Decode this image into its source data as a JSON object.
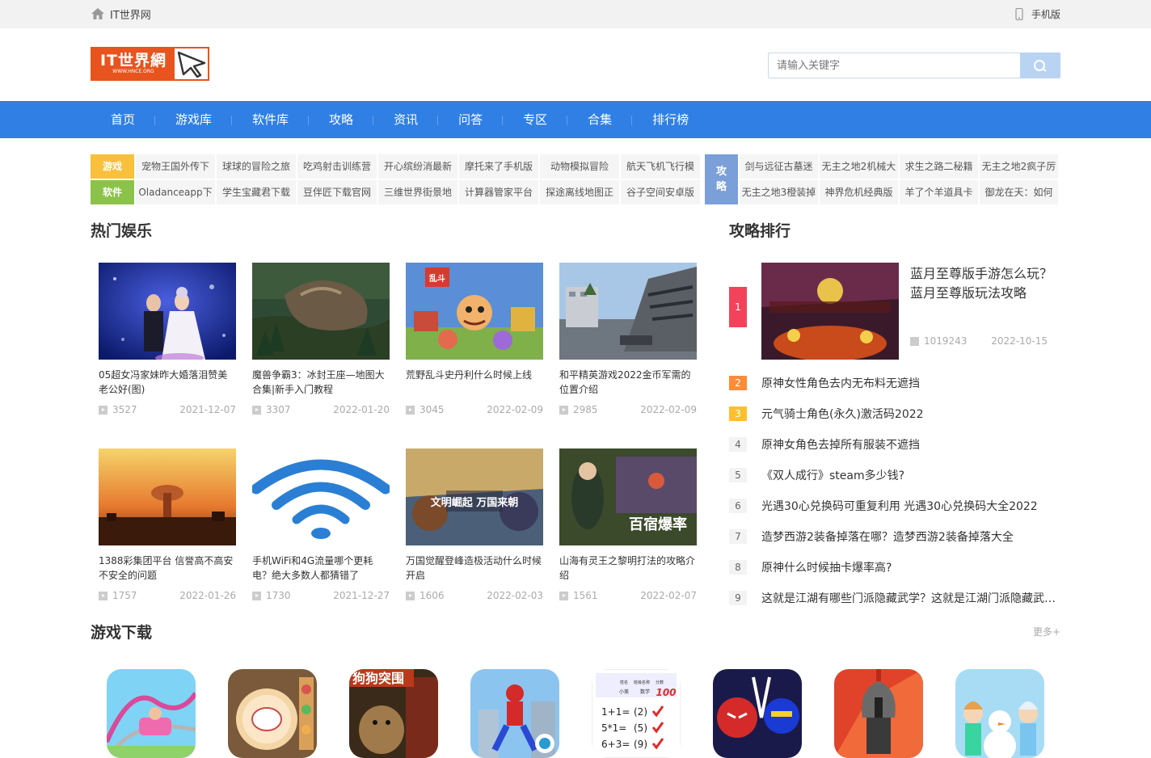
{
  "topbar": {
    "site_name": "IT世界网",
    "mobile_label": "手机版"
  },
  "logo": {
    "main": "IT世界網",
    "sub": "WWW.HNCE.ORG"
  },
  "search": {
    "placeholder": "请输入关键字"
  },
  "nav": [
    "首页",
    "游戏库",
    "软件库",
    "攻略",
    "资讯",
    "问答",
    "专区",
    "合集",
    "排行榜"
  ],
  "tags": {
    "games_label": "游戏",
    "games": [
      "宠物王国外传下",
      "球球的冒险之旅",
      "吃鸡射击训练营",
      "开心缤纷消最新",
      "摩托来了手机版",
      "动物模拟冒险",
      "航天飞机飞行模"
    ],
    "software_label": "软件",
    "software": [
      "Oladanceapp下",
      "学生宝藏君下载",
      "豆伴匠下载官网",
      "三维世界街景地",
      "计算器管家平台",
      "探途离线地图正",
      "谷子空间安卓版"
    ],
    "guide_label_1": "攻",
    "guide_label_2": "略",
    "guides": [
      "剑与远征古墓迷",
      "无主之地2机械大",
      "求生之路二秘籍",
      "无主之地2疯子厉",
      "无主之地3橙装掉",
      "神界危机经典版",
      "羊了个羊道具卡",
      "御龙在天：如何"
    ]
  },
  "sections": {
    "hot": "热门娱乐",
    "rank": "攻略排行",
    "download": "游戏下载",
    "more": "更多+"
  },
  "hot_cards": [
    {
      "title": "05超女冯家妹昨大婚落泪赞美老公好(图)",
      "views": "3527",
      "date": "2021-12-07"
    },
    {
      "title": "魔兽争霸3：冰封王座—地图大合集|新手入门教程",
      "views": "3307",
      "date": "2022-01-20"
    },
    {
      "title": "荒野乱斗史丹利什么时候上线",
      "views": "3045",
      "date": "2022-02-09"
    },
    {
      "title": "和平精英游戏2022金币军需的位置介绍",
      "views": "2985",
      "date": "2022-02-09"
    },
    {
      "title": "1388彩集团平台 信誉高不高安不安全的问题",
      "views": "1757",
      "date": "2022-01-26"
    },
    {
      "title": "手机WiFi和4G流量哪个更耗电？绝大多数人都猜错了",
      "views": "1730",
      "date": "2021-12-27"
    },
    {
      "title": "万国觉醒登峰造极活动什么时候开启",
      "views": "1606",
      "date": "2022-02-03"
    },
    {
      "title": "山海有灵王之黎明打法的攻略介绍",
      "views": "1561",
      "date": "2022-02-07"
    }
  ],
  "rank_top": {
    "num": "1",
    "title": "蓝月至尊版手游怎么玩？蓝月至尊版玩法攻略",
    "views": "1019243",
    "date": "2022-10-15"
  },
  "rank_list": [
    {
      "n": "2",
      "title": "原神女性角色去内无布料无遮挡"
    },
    {
      "n": "3",
      "title": "元气骑士角色(永久)激活码2022"
    },
    {
      "n": "4",
      "title": "原神女角色去掉所有服装不遮挡"
    },
    {
      "n": "5",
      "title": "《双人成行》steam多少钱?"
    },
    {
      "n": "6",
      "title": "光遇30心兑换码可重复利用 光遇30心兑换码大全2022"
    },
    {
      "n": "7",
      "title": "造梦西游2装备掉落在哪？造梦西游2装备掉落大全"
    },
    {
      "n": "8",
      "title": "原神什么时候抽卡爆率高?"
    },
    {
      "n": "9",
      "title": "这就是江湖有哪些门派隐藏武学？这就是江湖门派隐藏武学一览"
    }
  ],
  "apps": [
    "app-coaster-icon",
    "app-kitty-cooking-icon",
    "app-dog-attack-icon",
    "app-spiderman-icon",
    "app-math-quiz-icon",
    "app-stick-hero-icon",
    "app-spartan-icon",
    "app-snow-princess-icon"
  ],
  "app_text": {
    "dog_title": "狗狗突围",
    "math_lines": [
      "1+1=",
      "5*1=",
      "6+3="
    ],
    "math_answers": [
      "(2)",
      "(5)",
      "(9)"
    ],
    "math_score": "100",
    "math_header": [
      "姓名",
      "班级名称",
      "分数"
    ],
    "math_row": [
      "小美",
      "数学"
    ]
  },
  "card_overlays": {
    "c3_logo": "乱斗",
    "c7_text": "文明崛起 万国来朝",
    "c8_text": "百宿爆率"
  },
  "colors": {
    "nav": "#2f7fe5",
    "games_label": "#f9c03c",
    "software_label": "#8bc34a",
    "guide_label": "#7b9fd9",
    "rank1": "#f2435a",
    "rank2": "#fb8c3a",
    "rank3": "#fbc02d",
    "logo": "#e8541e"
  }
}
